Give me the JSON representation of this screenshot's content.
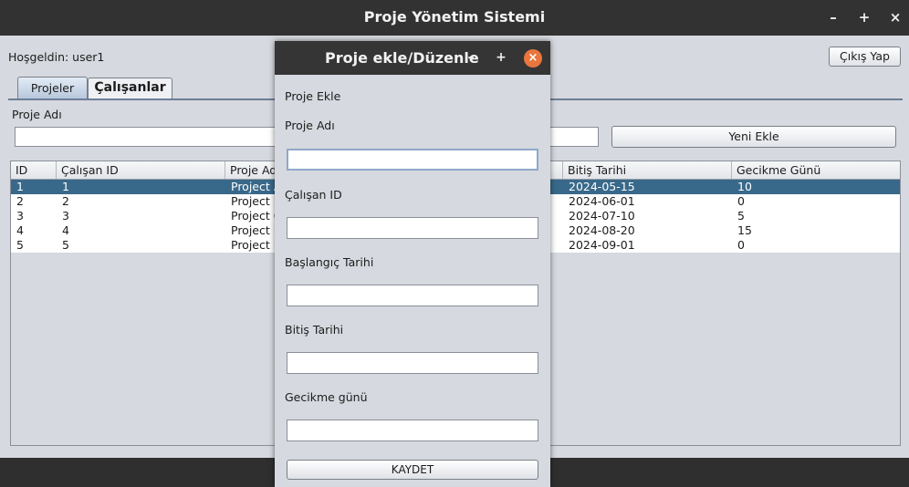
{
  "window": {
    "title": "Proje Yönetim Sistemi",
    "controls": {
      "minimize": "–",
      "maximize": "+",
      "close": "×"
    }
  },
  "header": {
    "welcome": "Hoşgeldin: user1",
    "logout_label": "Çıkış Yap"
  },
  "tabs": [
    {
      "label": "Projeler",
      "active": true
    },
    {
      "label": "Çalışanlar",
      "active": false
    }
  ],
  "form": {
    "project_name_label": "Proje Adı",
    "project_name_value": "",
    "new_add_label": "Yeni Ekle"
  },
  "table": {
    "columns": [
      "ID",
      "Çalışan ID",
      "Proje Adı",
      "",
      "Bitiş Tarihi",
      "Gecikme Günü"
    ],
    "rows": [
      {
        "id": "1",
        "employee_id": "1",
        "project": "Project A",
        "end": "2024-05-15",
        "delay": "10",
        "selected": true
      },
      {
        "id": "2",
        "employee_id": "2",
        "project": "Project B",
        "end": "2024-06-01",
        "delay": "0",
        "selected": false
      },
      {
        "id": "3",
        "employee_id": "3",
        "project": "Project C",
        "end": "2024-07-10",
        "delay": "5",
        "selected": false
      },
      {
        "id": "4",
        "employee_id": "4",
        "project": "Project D",
        "end": "2024-08-20",
        "delay": "15",
        "selected": false
      },
      {
        "id": "5",
        "employee_id": "5",
        "project": "Project E",
        "end": "2024-09-01",
        "delay": "0",
        "selected": false
      }
    ]
  },
  "dialog": {
    "title": "Proje ekle/Düzenle",
    "controls": {
      "minimize": "–",
      "maximize": "+",
      "close": "×"
    },
    "heading": "Proje Ekle",
    "fields": [
      {
        "label": "Proje Adı",
        "value": ""
      },
      {
        "label": "Çalışan ID",
        "value": ""
      },
      {
        "label": "Başlangıç Tarihi",
        "value": ""
      },
      {
        "label": "Bitiş Tarihi",
        "value": ""
      },
      {
        "label": "Gecikme günü",
        "value": ""
      }
    ],
    "save_label": "KAYDET"
  },
  "colors": {
    "selection": "#39698a",
    "titlebar": "#323232",
    "panel": "#d6d9df",
    "close_accent": "#e9763c"
  }
}
